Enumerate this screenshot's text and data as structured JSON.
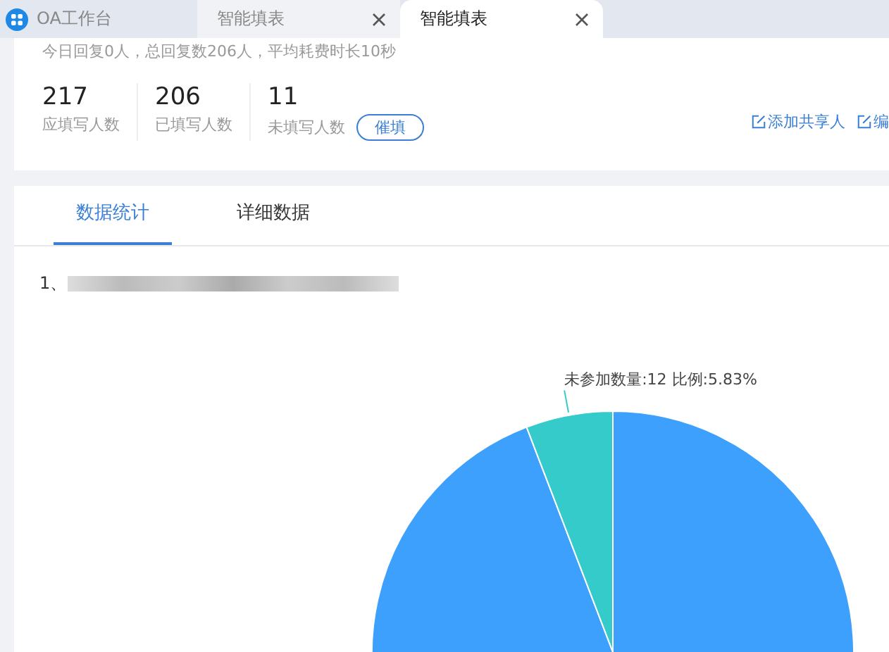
{
  "window_tabs": [
    {
      "label": "OA工作台",
      "kind": "home",
      "selected": false
    },
    {
      "label": "智能填表",
      "kind": "page",
      "selected": false
    },
    {
      "label": "智能填表",
      "kind": "page",
      "selected": true
    }
  ],
  "summary": "今日回复0人，总回复数206人，平均耗费时长10秒",
  "stats": [
    {
      "value": "217",
      "label": "应填写人数"
    },
    {
      "value": "206",
      "label": "已填写人数"
    },
    {
      "value": "11",
      "label": "未填写人数",
      "action": "催填"
    }
  ],
  "links": [
    "添加共享人",
    "编"
  ],
  "content_tabs": [
    {
      "label": "数据统计",
      "selected": true
    },
    {
      "label": "详细数据",
      "selected": false
    }
  ],
  "question": {
    "number": "1、"
  },
  "chart_data": {
    "type": "pie",
    "values": [
      94.17,
      5.83
    ],
    "colors": [
      "#3ca0fc",
      "#36cbcb"
    ],
    "annotations": [
      "未参加数量:12 比例:5.83%"
    ]
  }
}
